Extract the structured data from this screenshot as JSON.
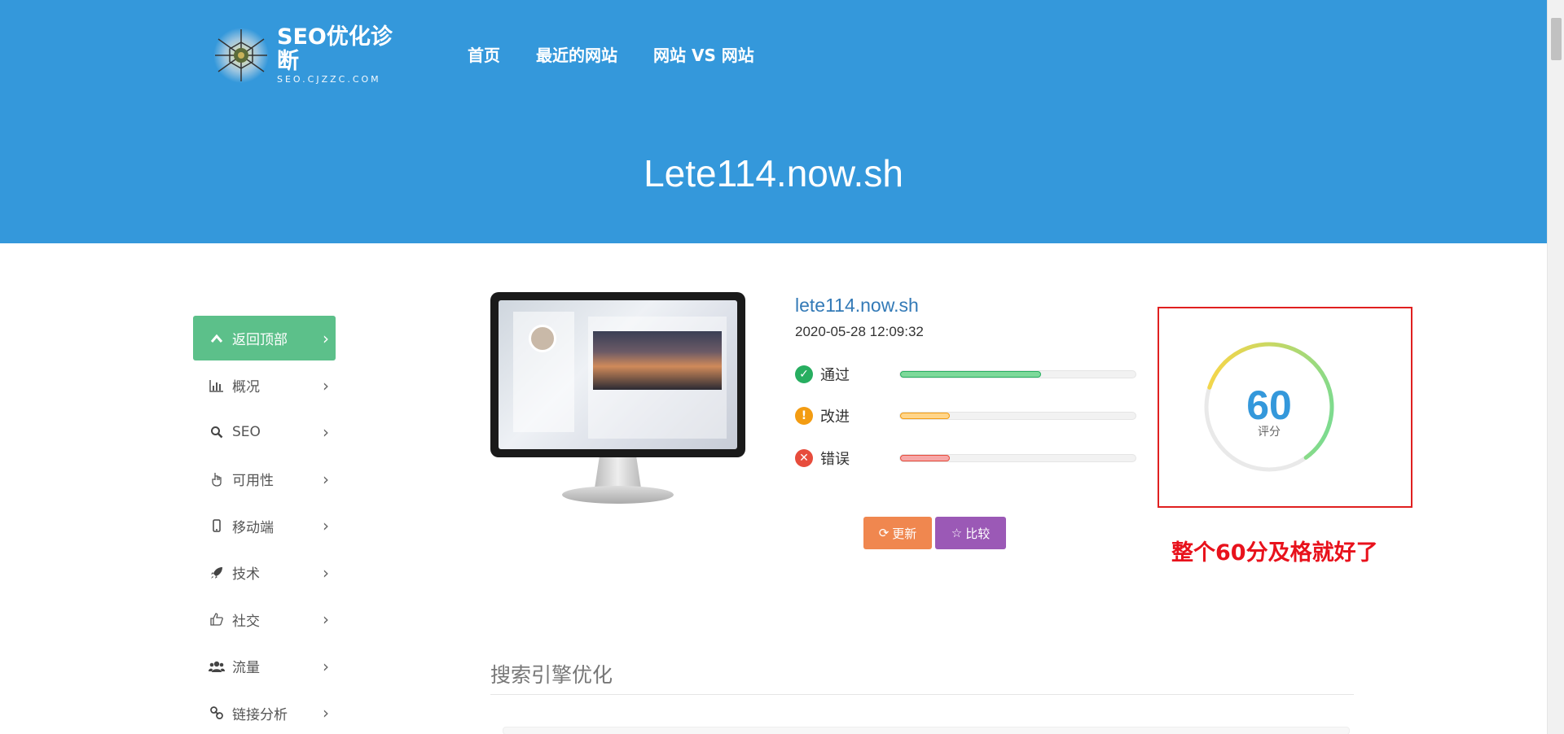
{
  "brand": {
    "title": "SEO优化诊断",
    "subtitle": "SEO.CJZZC.COM",
    "logo_icon": "spider-web-logo"
  },
  "nav": {
    "items": [
      "首页",
      "最近的网站",
      "网站 VS 网站"
    ]
  },
  "page": {
    "title": "Lete114.now.sh"
  },
  "sidebar": {
    "items": [
      {
        "label": "返回顶部",
        "icon": "chevron-up-icon",
        "active": true
      },
      {
        "label": "概况",
        "icon": "bar-chart-icon"
      },
      {
        "label": "SEO",
        "icon": "search-icon"
      },
      {
        "label": "可用性",
        "icon": "hand-pointer-icon"
      },
      {
        "label": "移动端",
        "icon": "mobile-icon"
      },
      {
        "label": "技术",
        "icon": "rocket-icon"
      },
      {
        "label": "社交",
        "icon": "thumbs-up-icon"
      },
      {
        "label": "流量",
        "icon": "users-icon"
      },
      {
        "label": "链接分析",
        "icon": "link-icon"
      }
    ]
  },
  "site": {
    "url": "lete114.now.sh",
    "date": "2020-05-28 12:09:32"
  },
  "stats": [
    {
      "label": "通过",
      "icon": "check-circle-icon",
      "color": "#27ae60",
      "fill_color": "#7ed99a",
      "level": 0.6
    },
    {
      "label": "改进",
      "icon": "exclamation-circle-icon",
      "color": "#f39c12",
      "fill_color": "#ffd58a",
      "level": 0.21
    },
    {
      "label": "错误",
      "icon": "x-circle-icon",
      "color": "#e74c3c",
      "fill_color": "#f7a7a7",
      "level": 0.21
    }
  ],
  "buttons": {
    "refresh": "更新",
    "compare": "比较"
  },
  "score": {
    "value": "60",
    "label": "评分",
    "level": 0.6
  },
  "annotation": "整个60分及格就好了",
  "section": {
    "title": "搜索引擎优化"
  },
  "colors": {
    "header": "#3498db",
    "sidebar_active": "#5cc08a",
    "annotation": "#e8121c"
  }
}
